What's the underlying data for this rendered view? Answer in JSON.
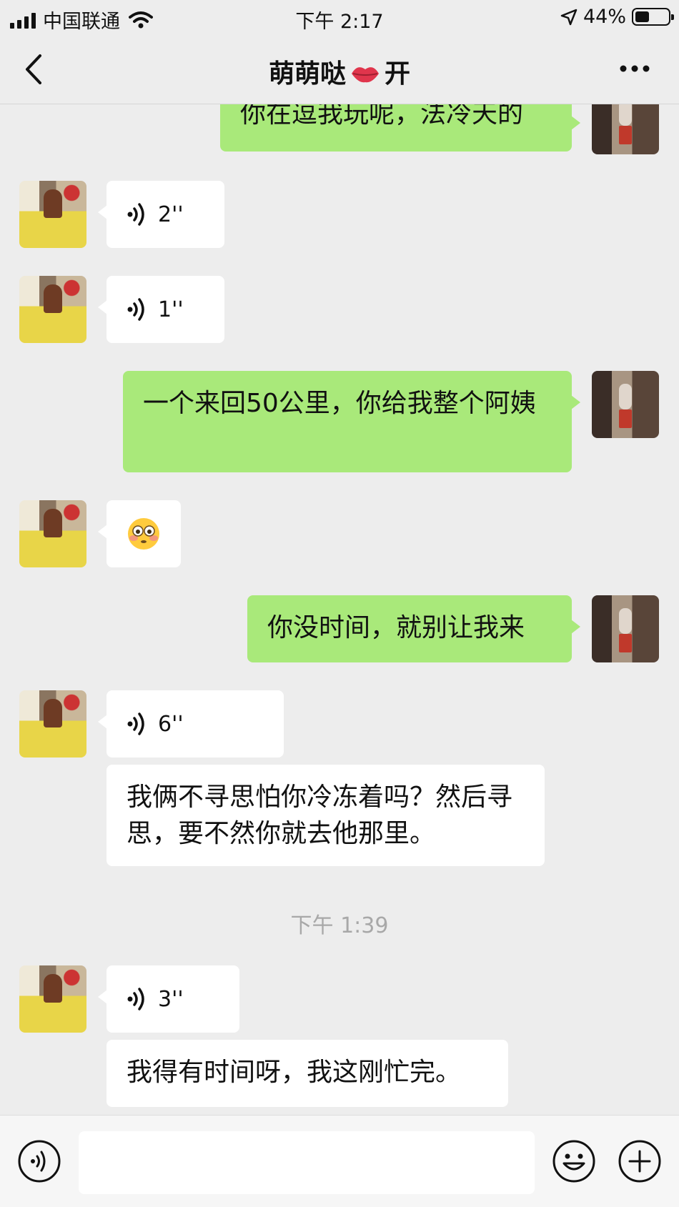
{
  "status_bar": {
    "carrier": "中国联通",
    "time": "下午 2:17",
    "battery": "44%",
    "battery_level": 0.44,
    "icons": [
      "signal-icon",
      "wifi-icon",
      "location-arrow-icon",
      "battery-icon"
    ]
  },
  "nav": {
    "title_part1": "萌萌哒",
    "title_emoji": "lips-icon",
    "title_part2": "开",
    "icons": [
      "back-icon",
      "more-icon"
    ]
  },
  "messages": [
    {
      "from": "me",
      "type": "text",
      "text": "你在逗我玩呢，法冷天的"
    },
    {
      "from": "other",
      "type": "voice",
      "duration": "2''"
    },
    {
      "from": "other",
      "type": "voice",
      "duration": "1''"
    },
    {
      "from": "me",
      "type": "text",
      "text": "一个来回50公里，你给我整个阿姨"
    },
    {
      "from": "other",
      "type": "emoji",
      "emoji": "flushed-face-icon"
    },
    {
      "from": "me",
      "type": "text",
      "text": "你没时间，就别让我来"
    },
    {
      "from": "other",
      "type": "voice",
      "duration": "6''"
    },
    {
      "from": "other",
      "type": "text",
      "text": "我俩不寻思怕你冷冻着吗？然后寻思，要不然你就去他那里。"
    },
    {
      "type": "timestamp",
      "text": "下午 1:39"
    },
    {
      "from": "other",
      "type": "voice",
      "duration": "3''"
    },
    {
      "from": "other",
      "type": "text",
      "text": "我得有时间呀，我这刚忙完。"
    }
  ],
  "input_bar": {
    "placeholder": "",
    "icons": [
      "voice-mode-icon",
      "emoji-icon",
      "plus-icon"
    ]
  },
  "colors": {
    "background": "#ededed",
    "my_bubble": "#a9e97a",
    "other_bubble": "#ffffff",
    "timestamp": "#a8a8a8"
  }
}
